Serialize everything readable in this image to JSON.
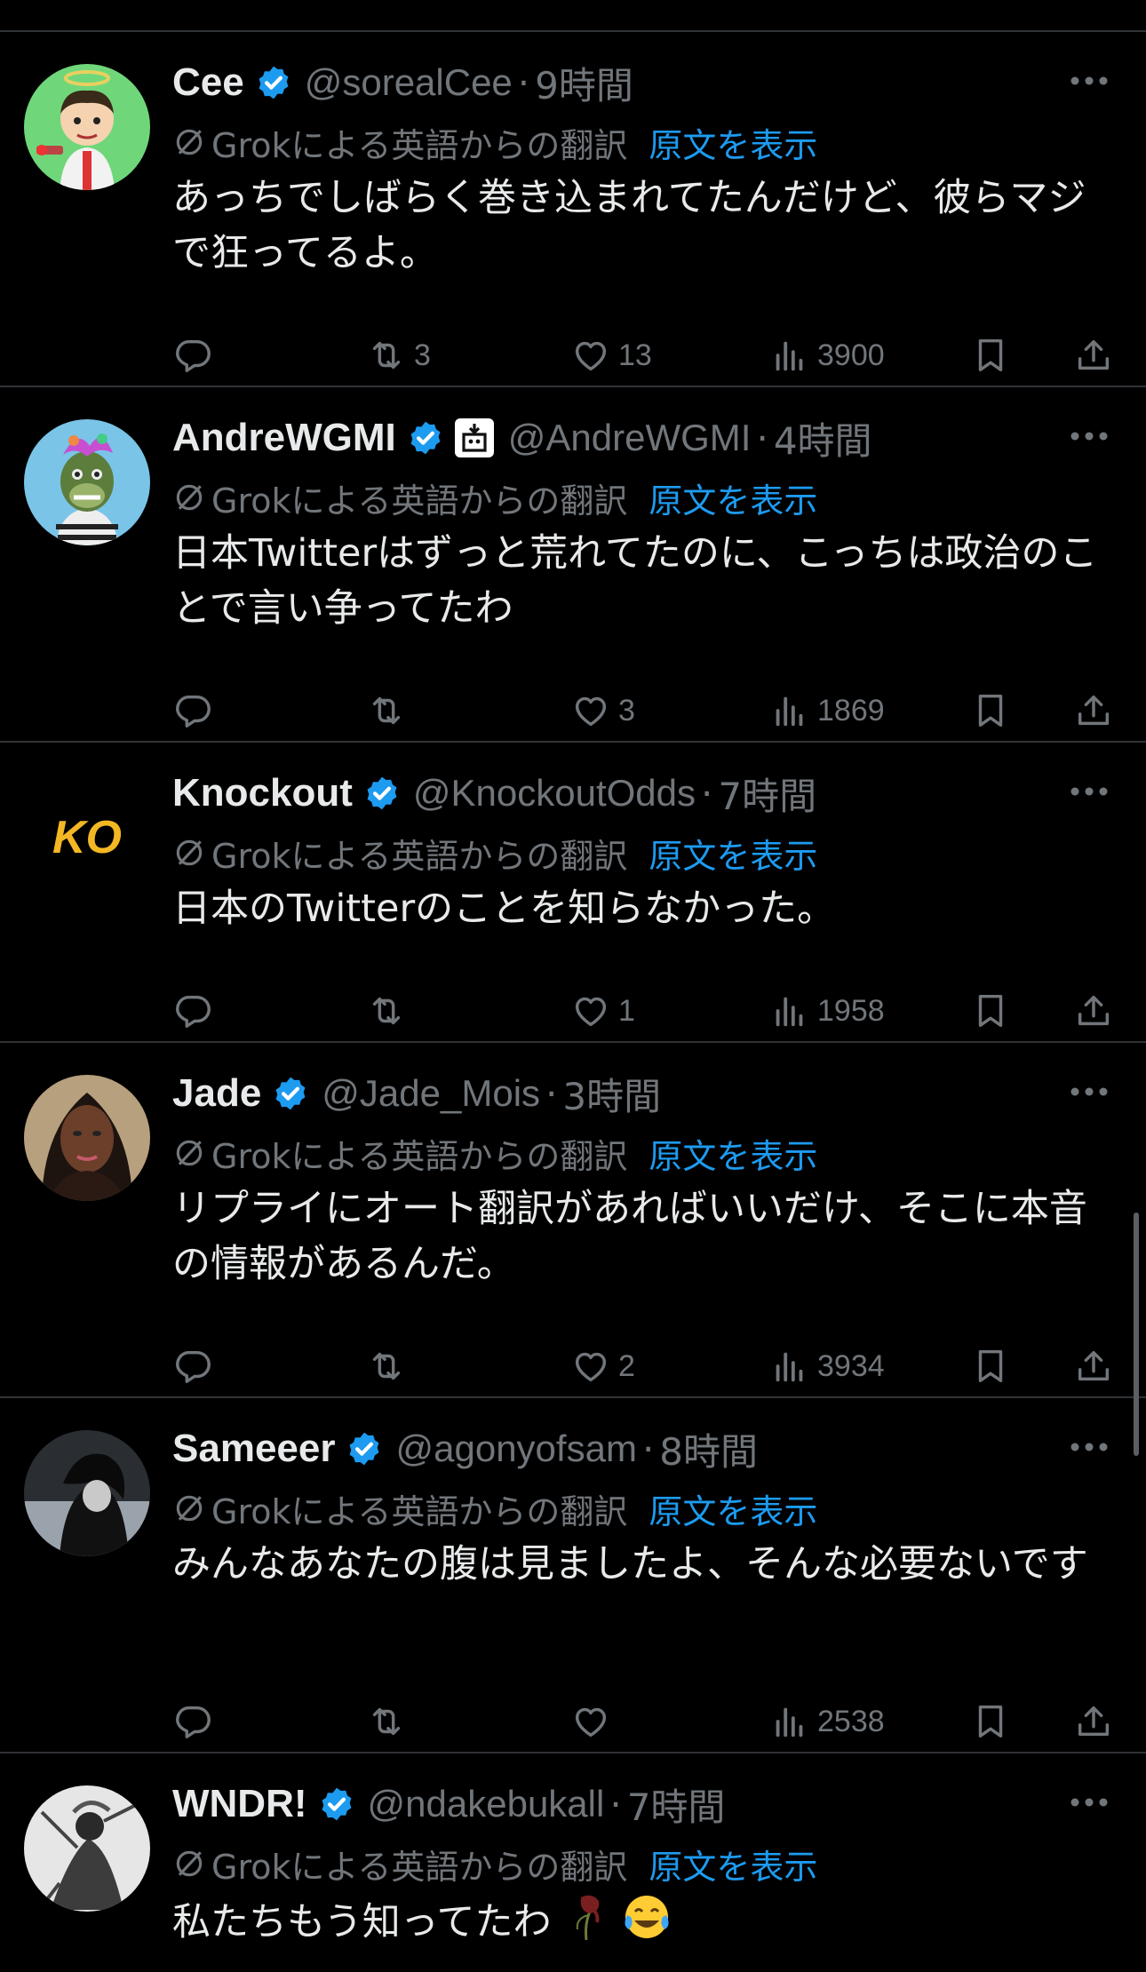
{
  "feed": {
    "translation_label": "Grokによる英語からの翻訳",
    "show_original_label": "原文を表示",
    "time_separator": "·",
    "colors": {
      "background": "#000000",
      "text": "#e7e9ea",
      "muted": "#71767b",
      "link": "#1d9bf0",
      "verified": "#1d9bf0",
      "divider": "#2f3336"
    },
    "posts": [
      {
        "name": "Cee",
        "handle": "@sorealCee",
        "time": "9時間",
        "text": "あっちでしばらく巻き込まれてたんだけど、彼らマジで狂ってるよ。",
        "replies": "",
        "reposts": "3",
        "likes": "13",
        "views": "3900",
        "avatar_icon": "cartoon-angel-avatar"
      },
      {
        "name": "AndreWGMI",
        "handle": "@AndreWGMI",
        "time": "4時間",
        "text": "日本Twitterはずっと荒れてたのに、こっちは政治のことで言い争ってたわ",
        "replies": "",
        "reposts": "",
        "likes": "3",
        "views": "1869",
        "avatar_icon": "ape-nft-avatar",
        "affiliation_icon": "affiliate-badge-icon"
      },
      {
        "name": "Knockout",
        "handle": "@KnockoutOdds",
        "time": "7時間",
        "text": "日本のTwitterのことを知らなかった。",
        "replies": "",
        "reposts": "",
        "likes": "1",
        "views": "1958",
        "avatar_icon": "ko-logo-avatar",
        "avatar_text": "KO"
      },
      {
        "name": "Jade",
        "handle": "@Jade_Mois",
        "time": "3時間",
        "text": "リプライにオート翻訳があればいいだけ、そこに本音の情報があるんだ。",
        "replies": "",
        "reposts": "",
        "likes": "2",
        "views": "3934",
        "avatar_icon": "woman-portrait-avatar"
      },
      {
        "name": "Sameeer",
        "handle": "@agonyofsam",
        "time": "8時間",
        "text": "みんなあなたの腹は見ましたよ、そんな必要ないです",
        "replies": "",
        "reposts": "",
        "likes": "",
        "views": "2538",
        "avatar_icon": "dark-anime-avatar"
      },
      {
        "name": "WNDR!",
        "handle": "@ndakebukall",
        "time": "7時間",
        "text": "私たちもう知ってたわ",
        "text_emojis": [
          "wilted-rose-emoji",
          "tears-of-joy-emoji"
        ],
        "avatar_icon": "sketch-warrior-avatar"
      }
    ]
  }
}
